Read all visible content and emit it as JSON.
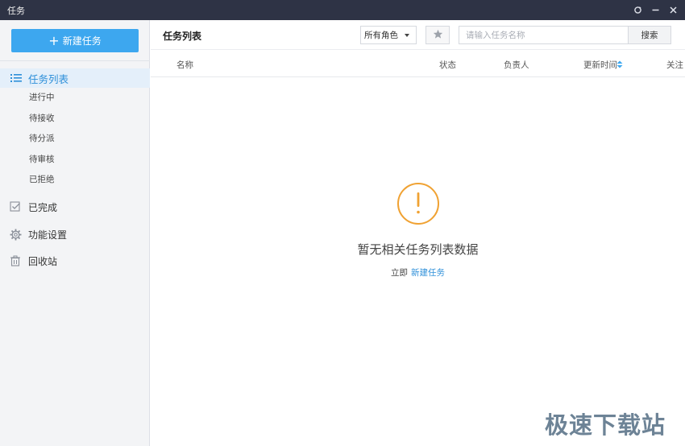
{
  "window": {
    "title": "任务"
  },
  "sidebar": {
    "new_task_label": "新建任务",
    "active_item": {
      "label": "任务列表",
      "icon": "list-icon"
    },
    "sub_items": [
      {
        "label": "进行中"
      },
      {
        "label": "待接收"
      },
      {
        "label": "待分派"
      },
      {
        "label": "待审核"
      },
      {
        "label": "已拒绝"
      }
    ],
    "items": [
      {
        "label": "已完成",
        "icon": "checkbox-icon"
      },
      {
        "label": "功能设置",
        "icon": "gear-icon"
      },
      {
        "label": "回收站",
        "icon": "trash-icon"
      }
    ]
  },
  "toolbar": {
    "page_title": "任务列表",
    "role_filter": {
      "selected": "所有角色"
    },
    "search": {
      "placeholder": "请输入任务名称",
      "value": "",
      "button_label": "搜索"
    }
  },
  "table": {
    "columns": [
      {
        "label": "名称"
      },
      {
        "label": "状态"
      },
      {
        "label": "负责人"
      },
      {
        "label": "更新时间",
        "sortable": true
      },
      {
        "label": "关注"
      }
    ]
  },
  "empty_state": {
    "message": "暂无相关任务列表数据",
    "action_prefix": "立即",
    "action_link": "新建任务",
    "accent_color": "#f0a233"
  },
  "watermark": {
    "text": "极速下载站"
  },
  "colors": {
    "primary": "#3da7ef",
    "titlebar": "#2e3345",
    "link": "#2d8fd9",
    "warning": "#f0a233"
  }
}
